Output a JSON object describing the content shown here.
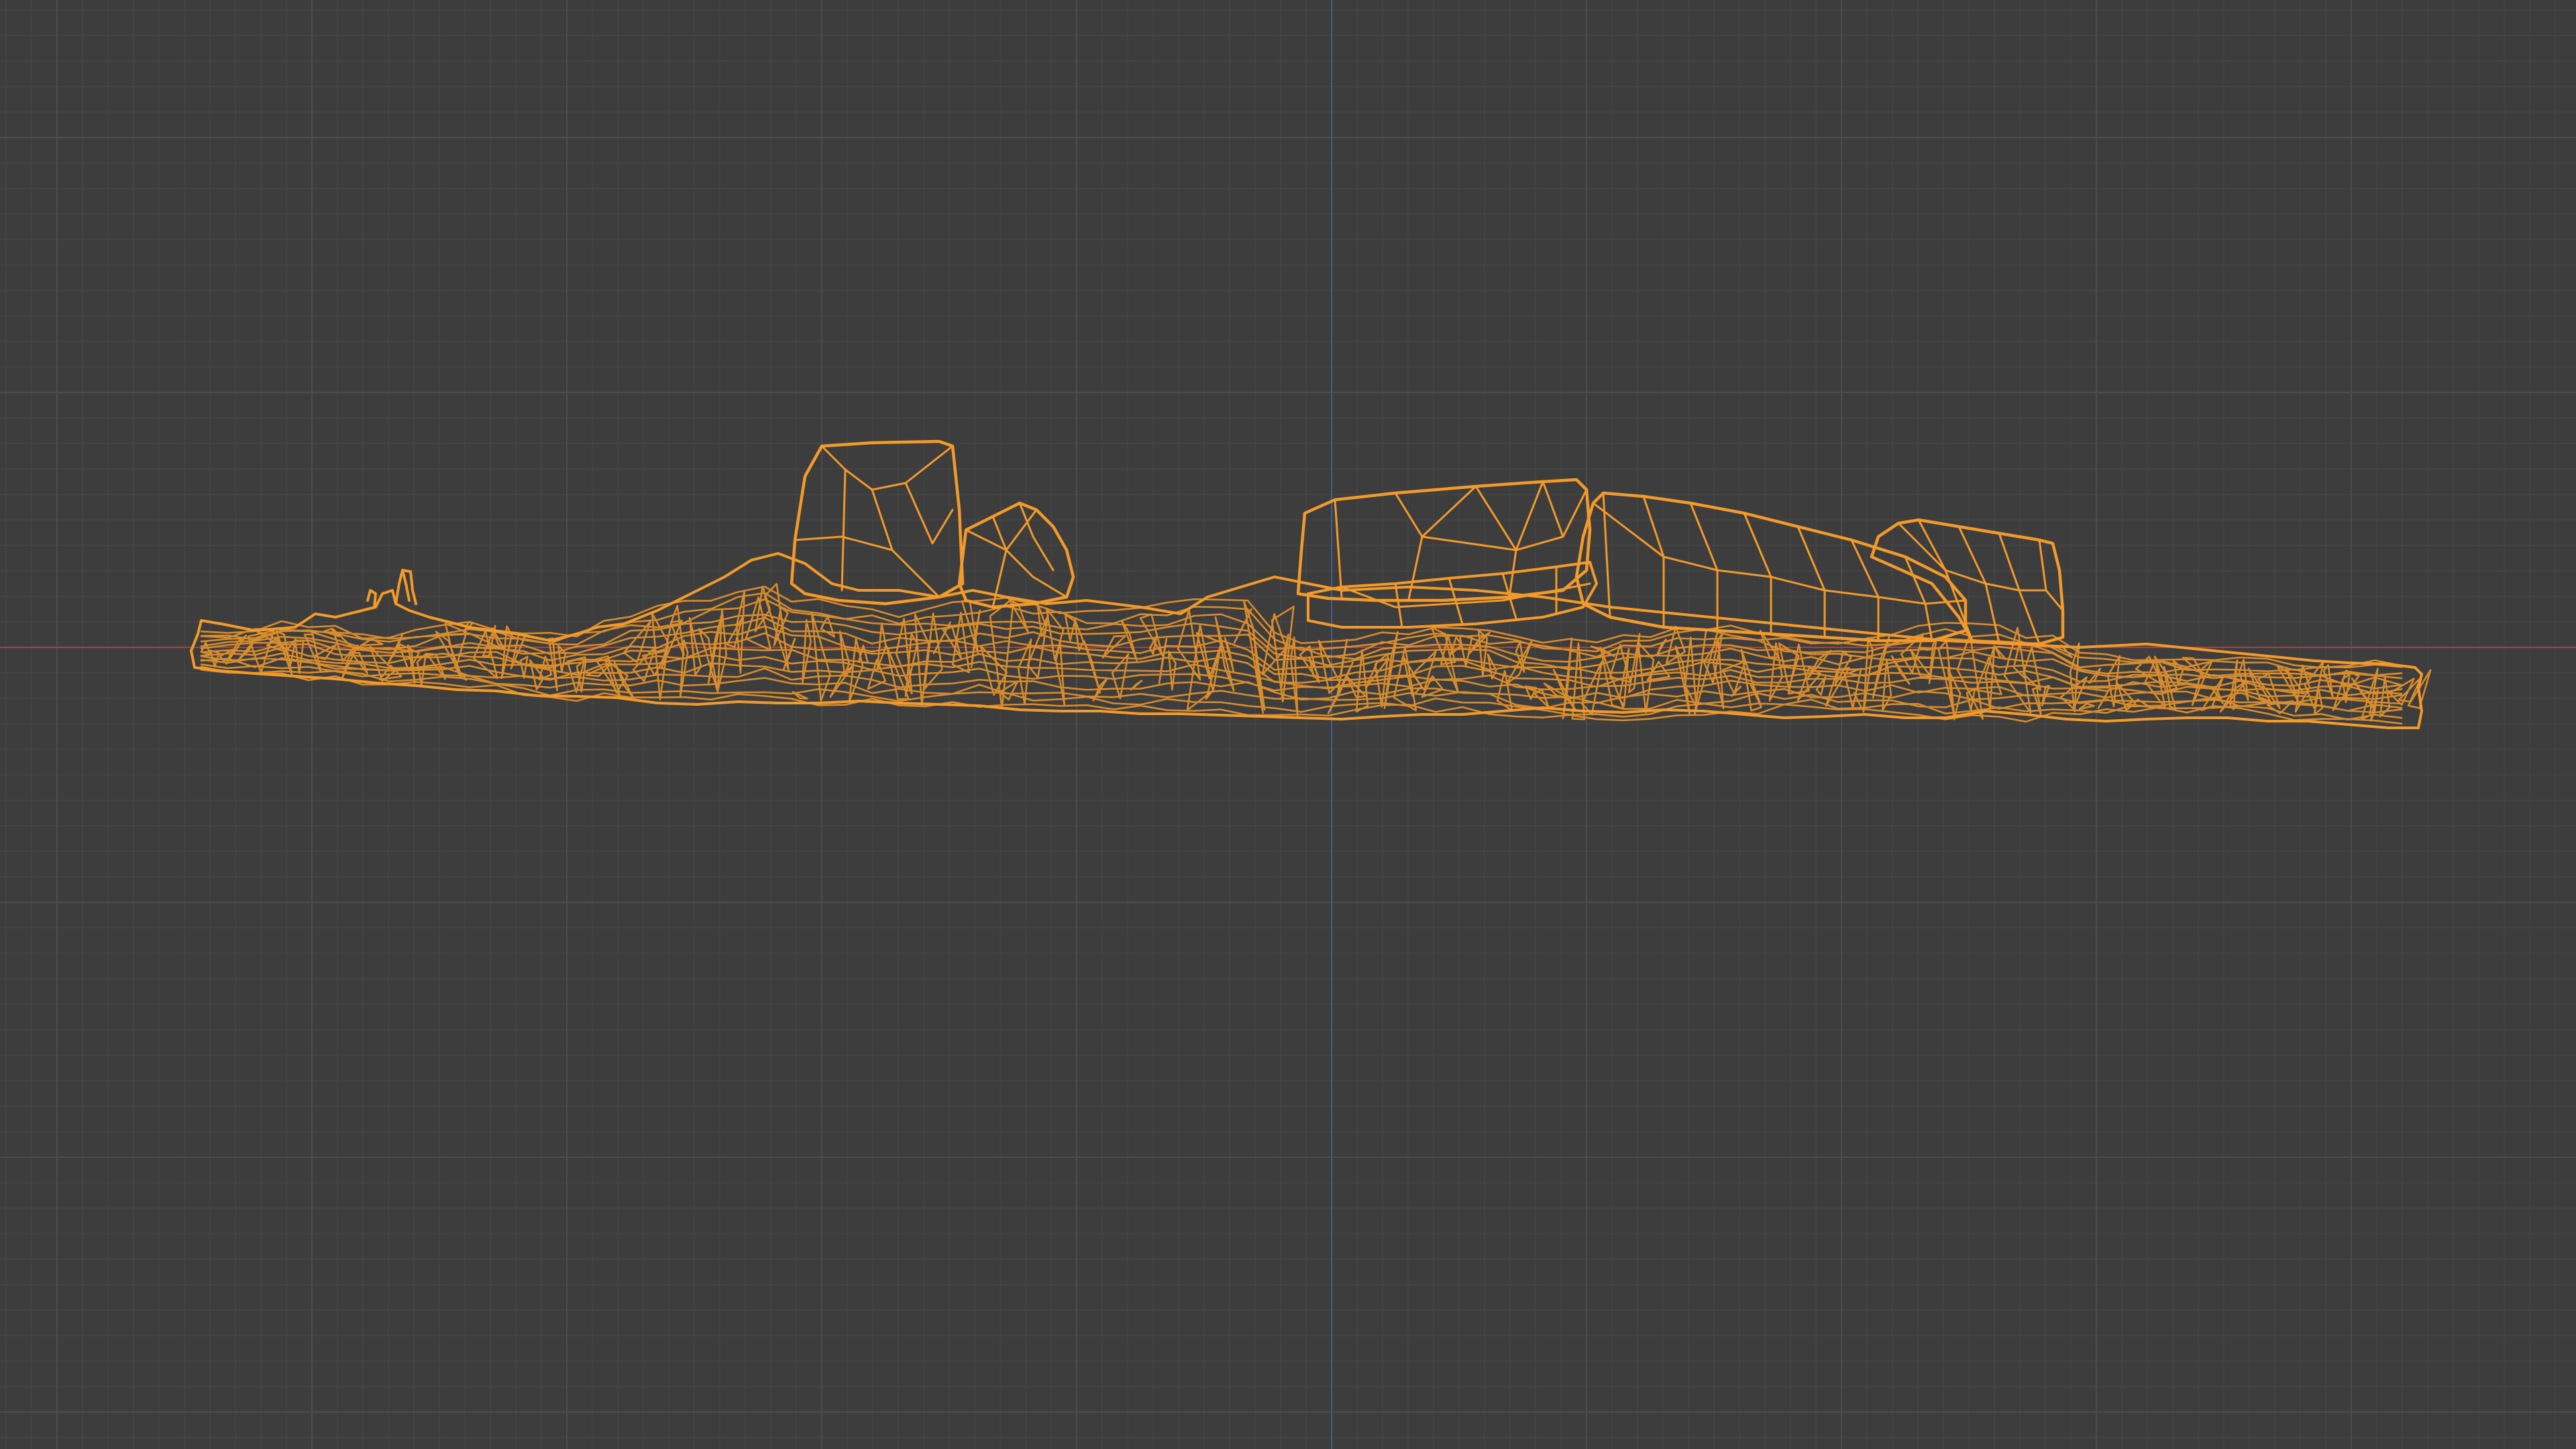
{
  "viewport": {
    "mode": "wireframe",
    "view": "orthographic-front",
    "background_color": "#3d3d3d",
    "grid_minor_color": "#454545",
    "grid_major_color": "#4d4d4d",
    "x_axis_color": "#9c4747",
    "z_axis_color": "#3f5f8f",
    "selected_object_color": "#f29a2a"
  },
  "object": {
    "name_icon": "mesh-object-icon",
    "kind": "rock-and-terrain-scan-mesh",
    "selected": true,
    "rock_count": 6
  }
}
